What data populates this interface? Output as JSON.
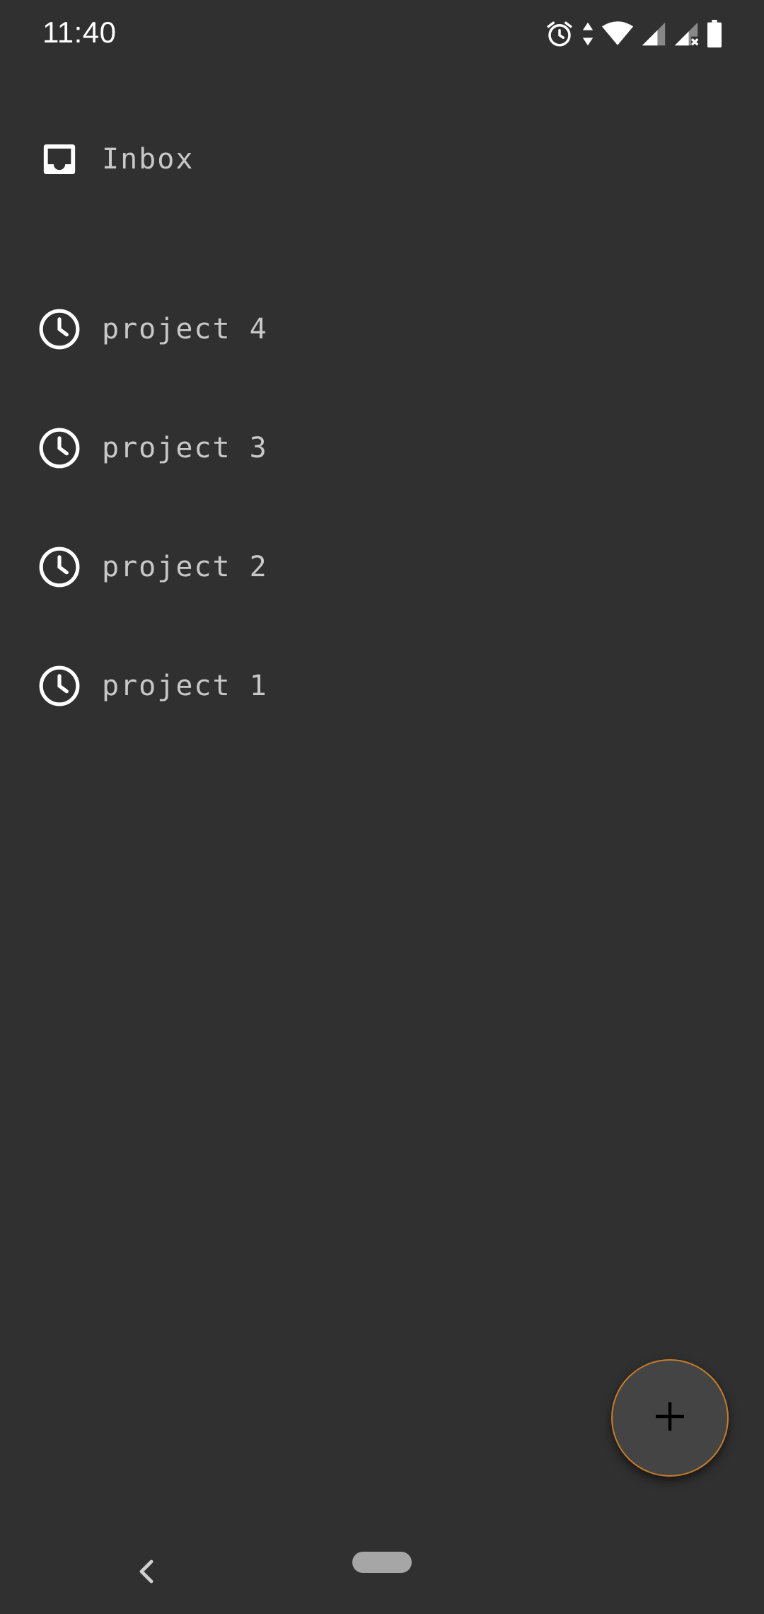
{
  "status_bar": {
    "time": "11:40",
    "icons": [
      "alarm-icon",
      "data-arrows-icon",
      "wifi-icon",
      "signal-icon",
      "signal-no-sim-icon",
      "battery-icon"
    ]
  },
  "inbox": {
    "label": "Inbox",
    "icon": "inbox-icon"
  },
  "projects": [
    {
      "label": "project 4",
      "icon": "clock-icon"
    },
    {
      "label": "project 3",
      "icon": "clock-icon"
    },
    {
      "label": "project 2",
      "icon": "clock-icon"
    },
    {
      "label": "project 1",
      "icon": "clock-icon"
    }
  ],
  "fab": {
    "icon": "plus-icon"
  },
  "colors": {
    "background": "#303030",
    "text": "#c8c8c8",
    "fab_border": "#c77d2a",
    "fab_fill": "#444444"
  }
}
